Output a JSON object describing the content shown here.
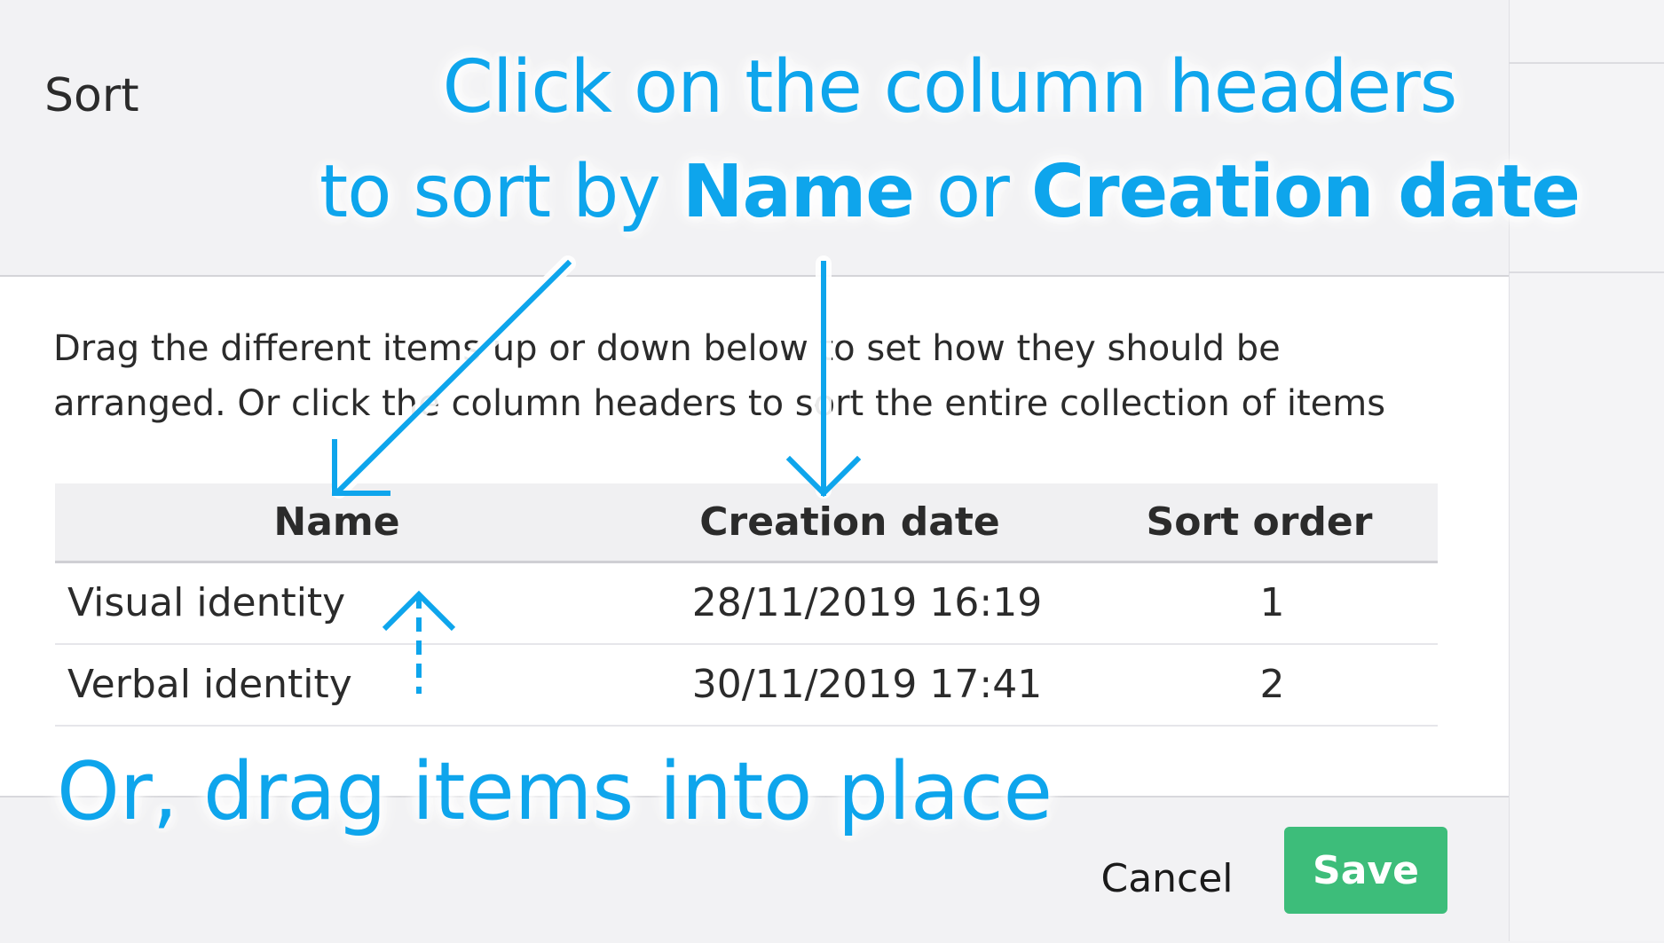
{
  "dialog": {
    "title": "Sort",
    "description": "Drag the different items up or down below to set how they should be arranged. Or click the column headers to sort the entire collection of items"
  },
  "table": {
    "headers": {
      "name": "Name",
      "creation_date": "Creation date",
      "sort_order": "Sort order"
    },
    "rows": [
      {
        "name": "Visual identity",
        "creation_date": "28/11/2019 16:19",
        "sort_order": "1"
      },
      {
        "name": "Verbal identity",
        "creation_date": "30/11/2019 17:41",
        "sort_order": "2"
      }
    ]
  },
  "footer": {
    "cancel_label": "Cancel",
    "save_label": "Save"
  },
  "annotations": {
    "top_line1": "Click on the column headers",
    "top_line2_prefix": "to sort by ",
    "top_line2_name": "Name",
    "top_line2_mid": " or ",
    "top_line2_date": "Creation date",
    "bottom": "Or, drag items into place"
  },
  "colors": {
    "accent": "#0ea5ec",
    "save_button": "#3dbd7a"
  }
}
